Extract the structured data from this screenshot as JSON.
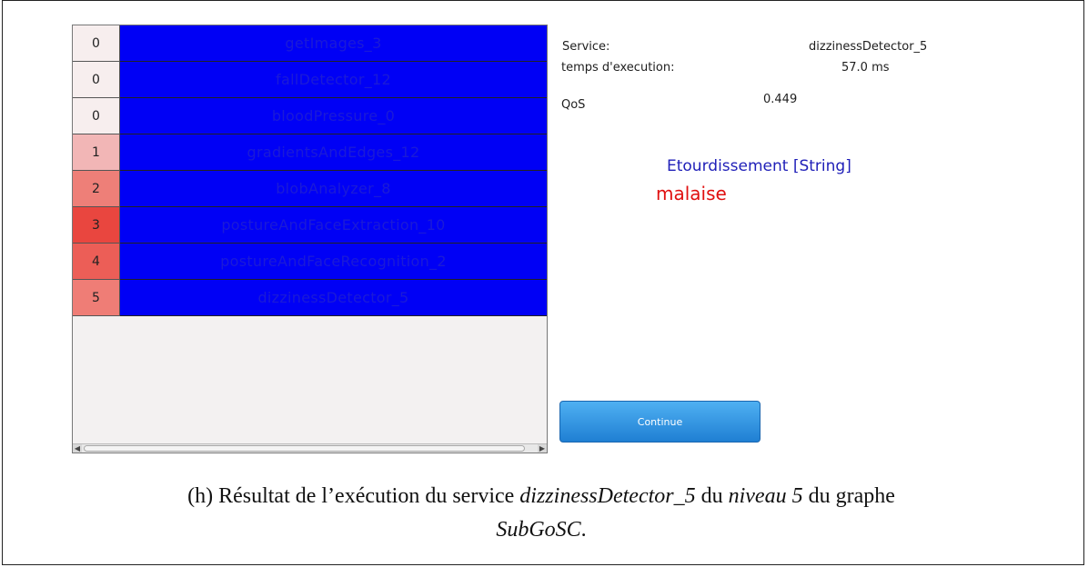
{
  "services": [
    {
      "level": "0",
      "name": "getImages_3",
      "level_color": "#f7eeee"
    },
    {
      "level": "0",
      "name": "fallDetector_12",
      "level_color": "#f7eeee"
    },
    {
      "level": "0",
      "name": "bloodPressure_0",
      "level_color": "#f7eeee"
    },
    {
      "level": "1",
      "name": "gradientsAndEdges_12",
      "level_color": "#f2b6b6"
    },
    {
      "level": "2",
      "name": "blobAnalyzer_8",
      "level_color": "#ee7f78"
    },
    {
      "level": "3",
      "name": "postureAndFaceExtraction_10",
      "level_color": "#e9463f"
    },
    {
      "level": "4",
      "name": "postureAndFaceRecognition_2",
      "level_color": "#ec5e57"
    },
    {
      "level": "5",
      "name": "dizzinessDetector_5",
      "level_color": "#ef7d76"
    }
  ],
  "info": {
    "service_label": "Service:",
    "service_value": "dizzinessDetector_5",
    "time_label": "temps d'execution:",
    "time_value": "57.0 ms",
    "qos_label": "QoS",
    "qos_value": "0.449"
  },
  "result": {
    "label": "Etourdissement [String]",
    "value": "malaise"
  },
  "continue_label": "Continue",
  "caption": {
    "prefix": "(h) Résultat de l’exécution du service ",
    "service": "dizzinessDetector_5",
    "middle1": " du ",
    "level": "niveau 5",
    "middle2": " du graphe",
    "graph": "SubGoSC",
    "end": "."
  },
  "colors": {
    "service_row_bg": "#0000f5",
    "service_text": "#1a1ad8",
    "result_value": "#e01010",
    "result_label": "#1f1fb8",
    "button_top": "#4fb0f2",
    "button_bottom": "#1f7fd3"
  }
}
